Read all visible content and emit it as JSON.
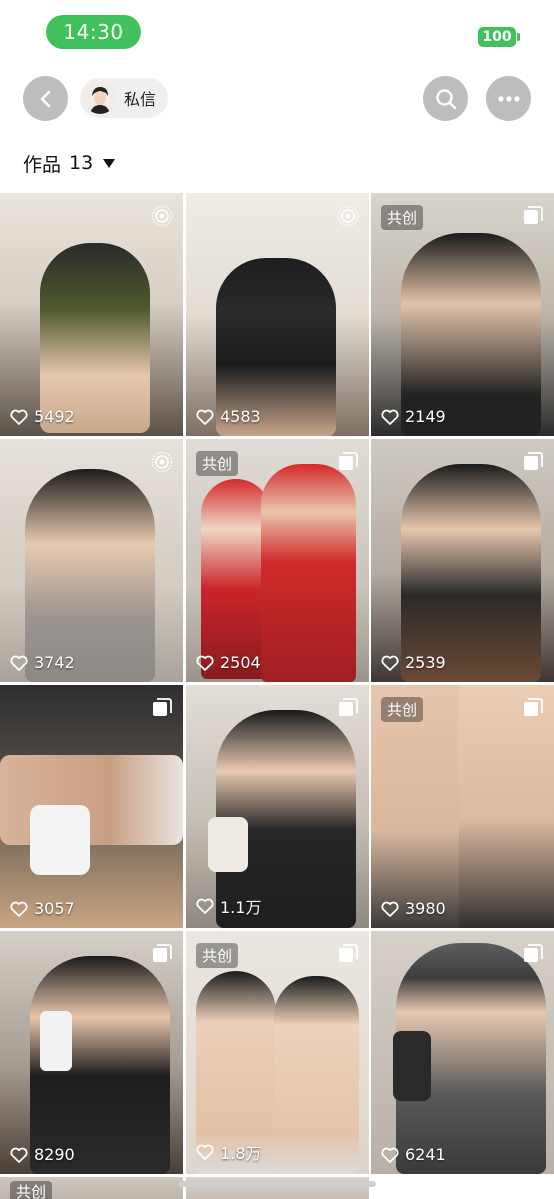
{
  "status": {
    "time": "14:30",
    "battery": "100"
  },
  "nav": {
    "dm_label": "私信"
  },
  "works": {
    "label": "作品",
    "count": "13"
  },
  "grid": {
    "items": [
      {
        "likes": "5492",
        "tag": "",
        "badge": "live"
      },
      {
        "likes": "4583",
        "tag": "",
        "badge": "live"
      },
      {
        "likes": "2149",
        "tag": "共创",
        "badge": "multi"
      },
      {
        "likes": "3742",
        "tag": "",
        "badge": "live"
      },
      {
        "likes": "2504",
        "tag": "共创",
        "badge": "multi"
      },
      {
        "likes": "2539",
        "tag": "",
        "badge": "multi"
      },
      {
        "likes": "3057",
        "tag": "",
        "badge": "multi"
      },
      {
        "likes": "1.1万",
        "tag": "",
        "badge": "multi"
      },
      {
        "likes": "3980",
        "tag": "共创",
        "badge": "multi"
      },
      {
        "likes": "8290",
        "tag": "",
        "badge": "multi"
      },
      {
        "likes": "1.8万",
        "tag": "共创",
        "badge": "multi"
      },
      {
        "likes": "6241",
        "tag": "",
        "badge": "multi"
      }
    ],
    "partial_row_tag": "共创"
  },
  "icons": {
    "back": "chevron-left-icon",
    "search": "search-icon",
    "more": "more-dots-icon",
    "heart": "heart-outline-icon",
    "live": "live-photo-icon",
    "multi": "multi-image-icon"
  },
  "colors": {
    "status_green": "#41c15b",
    "nav_button": "#bdbdbd",
    "pill_bg": "#efefef"
  }
}
